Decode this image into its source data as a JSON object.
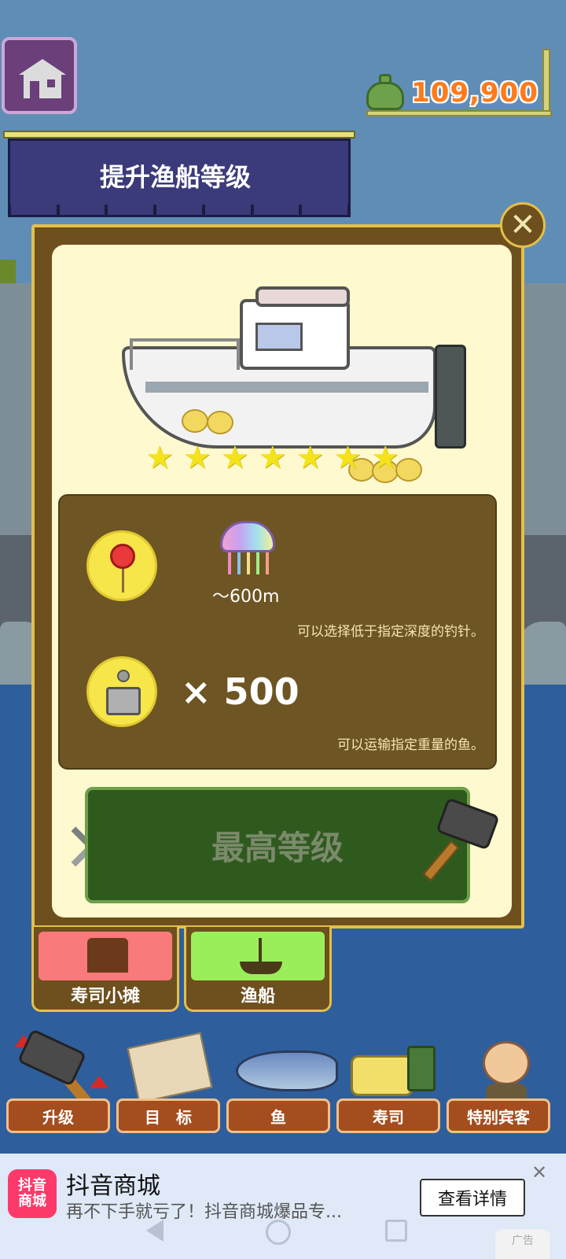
{
  "header": {
    "money": "109,900"
  },
  "banner": {
    "title": "提升渔船等级"
  },
  "modal": {
    "close_symbol": "✕",
    "stars": [
      "★",
      "★",
      "★",
      "★",
      "★",
      "★",
      "★"
    ],
    "star_count": 7,
    "hook": {
      "depth": "～600m",
      "description": "可以选择低于指定深度的钓针。"
    },
    "capacity": {
      "value": "× 500",
      "description": "可以运输指定重量的鱼。"
    },
    "max_button_label": "最高等级"
  },
  "categories": [
    {
      "label": "寿司小摊"
    },
    {
      "label": "渔船"
    }
  ],
  "bottom_nav": [
    {
      "label": "升级",
      "icon": "hammer-icon"
    },
    {
      "label": "目　标",
      "icon": "map-icon"
    },
    {
      "label": "鱼",
      "icon": "fish-icon"
    },
    {
      "label": "寿司",
      "icon": "sushi-icon"
    },
    {
      "label": "特别宾客",
      "icon": "guest-icon"
    }
  ],
  "ad": {
    "logo_text": "抖音\n商城",
    "title": "抖音商城",
    "subtitle": "再不下手就亏了！抖音商城爆品专...",
    "button_label": "查看详情",
    "close_symbol": "✕",
    "tag": "广告"
  },
  "colors": {
    "money": "#ff7a1a",
    "banner": "#3b3a7a",
    "modal_frame": "#6e4f1e",
    "modal_inner": "#fff9cf",
    "max_button": "#2f5a1e",
    "nav_label": "#a44d1e",
    "star": "#f4e31a"
  }
}
